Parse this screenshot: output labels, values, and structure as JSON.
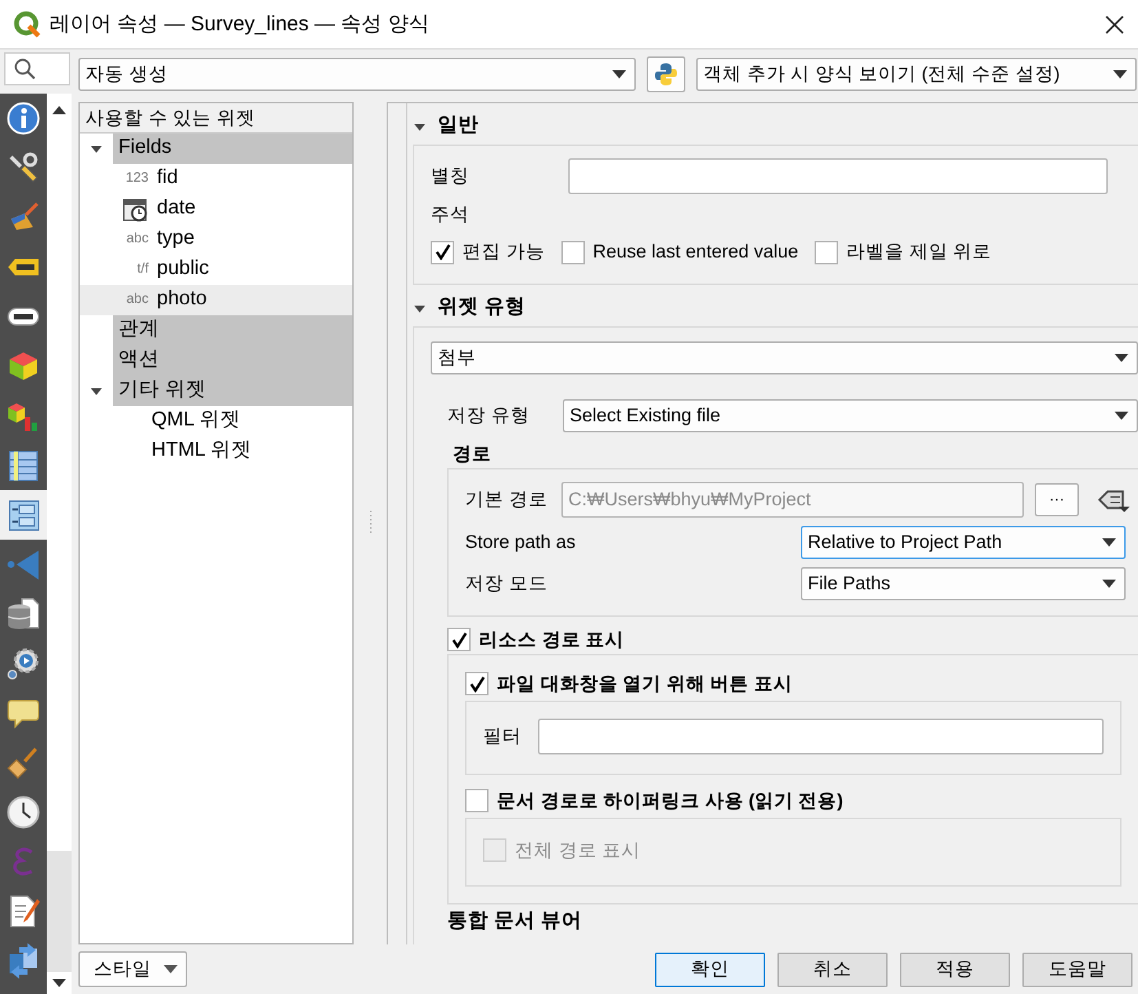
{
  "window": {
    "title": "레이어 속성 — Survey_lines — 속성 양식"
  },
  "sidebar": {
    "items": [
      {
        "selected": false
      },
      {
        "selected": false
      },
      {
        "selected": false
      },
      {
        "selected": false
      },
      {
        "selected": false
      },
      {
        "selected": false
      },
      {
        "selected": false
      },
      {
        "selected": false
      },
      {
        "selected": true
      },
      {
        "selected": false
      },
      {
        "selected": false
      },
      {
        "selected": false
      },
      {
        "selected": false
      },
      {
        "selected": false
      },
      {
        "selected": false
      },
      {
        "selected": false
      },
      {
        "selected": false
      },
      {
        "selected": false
      }
    ]
  },
  "toolbar": {
    "layout_combo": "자동 생성",
    "form_combo": "객체 추가 시 양식 보이기 (전체 수준 설정)"
  },
  "widget_tree": {
    "header": "사용할 수 있는 위젯",
    "items": [
      {
        "label": "Fields",
        "expanded": true,
        "children": [
          {
            "label": "fid",
            "kind": "badge",
            "badge": "123",
            "selected": false
          },
          {
            "label": "date",
            "kind": "calendar",
            "selected": false
          },
          {
            "label": "type",
            "kind": "badge",
            "badge": "abc",
            "selected": false
          },
          {
            "label": "public",
            "kind": "badge",
            "badge": "t/f",
            "selected": false
          },
          {
            "label": "photo",
            "kind": "badge",
            "badge": "abc",
            "selected": true
          }
        ]
      },
      {
        "label": "관계"
      },
      {
        "label": "액션"
      },
      {
        "label": "기타 위젯",
        "expanded": true,
        "children": [
          {
            "label": "QML 위젯"
          },
          {
            "label": "HTML 위젯"
          }
        ]
      }
    ]
  },
  "general": {
    "title": "일반",
    "expanded": true,
    "alias_label": "별칭",
    "comment_label": "주석",
    "options": [
      {
        "label": "편집 가능",
        "checked": true
      },
      {
        "label": "Reuse last entered value",
        "checked": false
      },
      {
        "label": "라벨을 제일 위로",
        "checked": false
      }
    ]
  },
  "widget_type": {
    "title": "위젯 유형",
    "expanded": true,
    "type_combo": "첨부",
    "storage_label": "저장 유형",
    "storage_combo": "Select Existing file",
    "path": {
      "title": "경로",
      "default_path_label": "기본 경로",
      "default_path_value": "C:₩Users₩bhyu₩MyProject",
      "default_path_disabled": true,
      "browse_button": "···",
      "rows": [
        {
          "label": "Store path as",
          "value": "Relative to Project Path",
          "focused": true
        },
        {
          "label": "저장 모드",
          "value": "File Paths",
          "focused": false
        }
      ]
    },
    "resource_path": {
      "label": "리소스 경로 표시",
      "checked": true,
      "button": {
        "label": "파일 대화창을 열기 위해 버튼 표시",
        "checked": true,
        "filter_label": "필터"
      },
      "hyperlink": {
        "label": "문서 경로로 하이퍼링크 사용 (읽기 전용)",
        "checked": false,
        "full_path": {
          "label": "전체 경로 표시",
          "checked": false,
          "disabled": true
        }
      }
    },
    "viewer_title": "통합 문서 뷰어"
  },
  "footer": {
    "style_button": "스타일",
    "buttons": [
      {
        "label": "확인",
        "default": true
      },
      {
        "label": "취소",
        "default": false
      },
      {
        "label": "적용",
        "default": false
      },
      {
        "label": "도움말",
        "default": false
      }
    ]
  }
}
